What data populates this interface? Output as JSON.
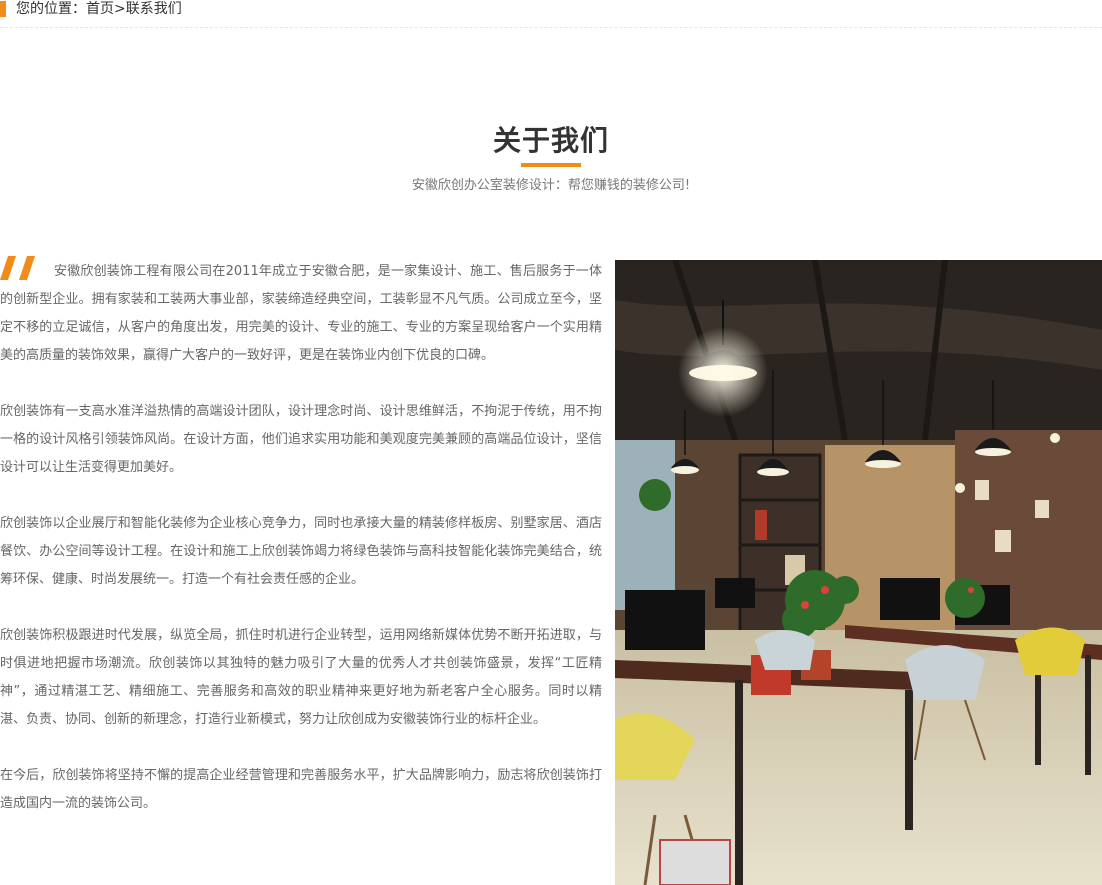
{
  "breadcrumb": {
    "text": "您的位置：首页>联系我们"
  },
  "section": {
    "title": "关于我们",
    "subtitle": "安徽欣创办公室装修设计：帮您赚钱的装修公司!"
  },
  "paragraphs": [
    "安徽欣创装饰工程有限公司在2011年成立于安徽合肥，是一家集设计、施工、售后服务于一体的创新型企业。拥有家装和工装两大事业部，家装缔造经典空间，工装彰显不凡气质。公司成立至今，坚定不移的立足诚信，从客户的角度出发，用完美的设计、专业的施工、专业的方案呈现给客户一个实用精美的高质量的装饰效果，赢得广大客户的一致好评，更是在装饰业内创下优良的口碑。",
    "欣创装饰有一支高水准洋溢热情的高端设计团队，设计理念时尚、设计思维鲜活，不拘泥于传统，用不拘一格的设计风格引领装饰风尚。在设计方面，他们追求实用功能和美观度完美兼顾的高端品位设计，坚信设计可以让生活变得更加美好。",
    "欣创装饰以企业展厅和智能化装修为企业核心竞争力，同时也承接大量的精装修样板房、别墅家居、酒店餐饮、办公空间等设计工程。在设计和施工上欣创装饰竭力将绿色装饰与高科技智能化装饰完美结合，统筹环保、健康、时尚发展统一。打造一个有社会责任感的企业。",
    "欣创装饰积极跟进时代发展，纵览全局，抓住时机进行企业转型，运用网络新媒体优势不断开拓进取，与时俱进地把握市场潮流。欣创装饰以其独特的魅力吸引了大量的优秀人才共创装饰盛景，发挥“工匠精神”，通过精湛工艺、精细施工、完善服务和高效的职业精神来更好地为新老客户全心服务。同时以精湛、负责、协同、创新的新理念，打造行业新模式，努力让欣创成为安徽装饰行业的标杆企业。",
    "在今后，欣创装饰将坚持不懈的提高企业经营管理和完善服务水平，扩大品牌影响力，励志将欣创装饰打造成国内一流的装饰公司。"
  ],
  "colors": {
    "accent": "#f08c1a",
    "text": "#333333",
    "muted": "#666666"
  },
  "icons": {
    "quote": "quote-icon",
    "photo": "office-photo"
  }
}
